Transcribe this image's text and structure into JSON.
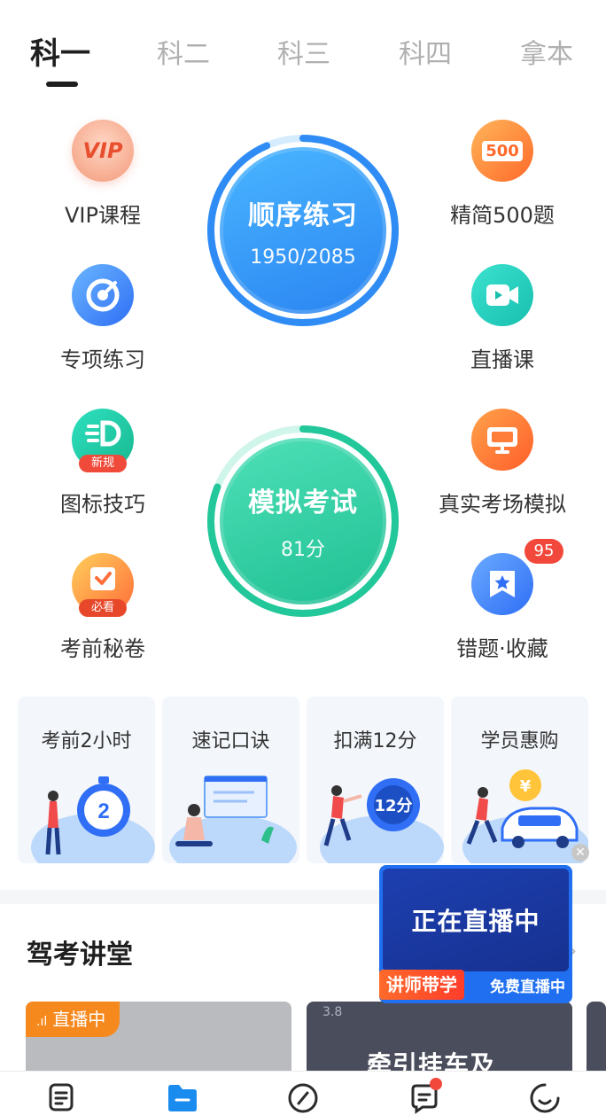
{
  "tabs": [
    {
      "label": "科一",
      "active": true
    },
    {
      "label": "科二",
      "active": false
    },
    {
      "label": "科三",
      "active": false
    },
    {
      "label": "科四",
      "active": false
    },
    {
      "label": "拿本",
      "active": false
    }
  ],
  "features_left": [
    {
      "label": "VIP课程",
      "icon": "vip-icon",
      "icon_text": "VIP"
    },
    {
      "label": "专项练习",
      "icon": "target-icon"
    },
    {
      "label": "图标技巧",
      "icon": "sign-rule-icon",
      "tag": "新规"
    },
    {
      "label": "考前秘卷",
      "icon": "exam-paper-icon",
      "tag": "必看"
    }
  ],
  "features_right": [
    {
      "label": "精简500题",
      "icon": "500-questions-icon",
      "icon_text": "500"
    },
    {
      "label": "直播课",
      "icon": "live-video-icon"
    },
    {
      "label": "真实考场模拟",
      "icon": "monitor-icon"
    },
    {
      "label": "错题·收藏",
      "icon": "bookmark-star-icon",
      "badge": "95"
    }
  ],
  "practice": {
    "title": "顺序练习",
    "progress_text": "1950/2085",
    "done": 1950,
    "total": 2085,
    "color": "#2f8cf5"
  },
  "mock_exam": {
    "title": "模拟考试",
    "score_text": "81分",
    "score": 81,
    "max": 100,
    "color": "#22c79a"
  },
  "cards": [
    {
      "title": "考前2小时",
      "illustration": "stopwatch-icon",
      "illu_text": "2"
    },
    {
      "title": "速记口诀",
      "illustration": "whiteboard-icon"
    },
    {
      "title": "扣满12分",
      "illustration": "points-clock-icon",
      "illu_text": "12分"
    },
    {
      "title": "学员惠购",
      "illustration": "car-coin-icon",
      "illu_text": "¥"
    }
  ],
  "section": {
    "title": "驾考讲堂"
  },
  "live_popup": {
    "title": "正在直播中",
    "left_tag": "讲师带学",
    "right_tag": "免费直播中"
  },
  "courses": [
    {
      "tag": "直播中"
    },
    {
      "number": "3.8",
      "title": "牵引挂车及"
    }
  ],
  "nav": [
    {
      "name": "nav-home",
      "icon": "document-icon"
    },
    {
      "name": "nav-study",
      "icon": "folder-icon",
      "active": true
    },
    {
      "name": "nav-discover",
      "icon": "compass-icon"
    },
    {
      "name": "nav-community",
      "icon": "chat-icon",
      "dot": true
    },
    {
      "name": "nav-me",
      "icon": "smile-icon"
    }
  ],
  "colors": {
    "active_nav": "#1a8cf0",
    "inactive_nav": "#2b2b2b",
    "badge": "#f2483c"
  }
}
